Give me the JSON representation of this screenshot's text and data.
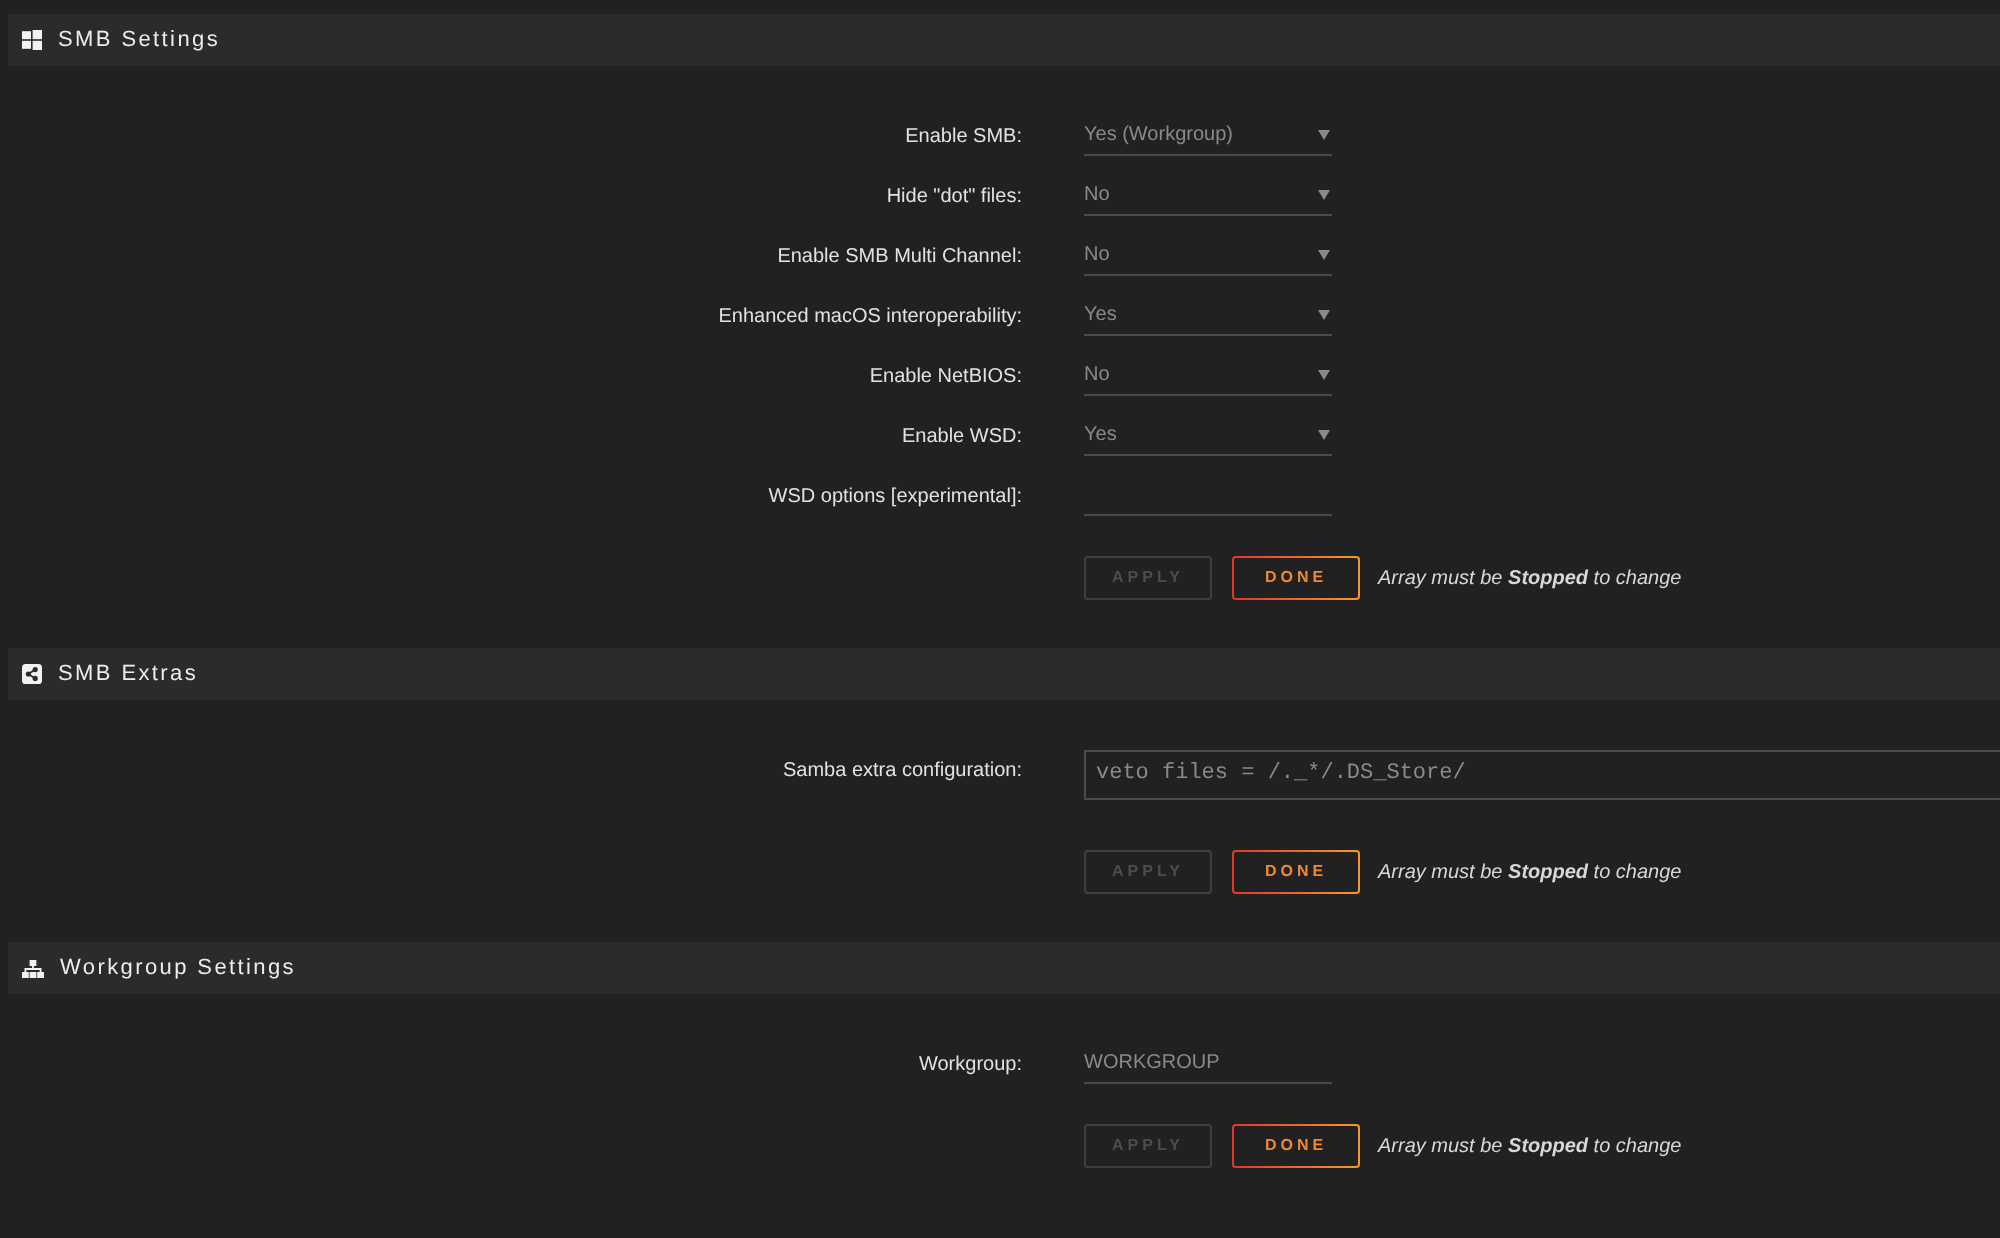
{
  "smb_settings": {
    "title": "SMB Settings",
    "fields": [
      {
        "kind": "select",
        "label": "Enable SMB:",
        "value": "Yes (Workgroup)"
      },
      {
        "kind": "select",
        "label": "Hide \"dot\" files:",
        "value": "No"
      },
      {
        "kind": "select",
        "label": "Enable SMB Multi Channel:",
        "value": "No"
      },
      {
        "kind": "select",
        "label": "Enhanced macOS interoperability:",
        "value": "Yes"
      },
      {
        "kind": "select",
        "label": "Enable NetBIOS:",
        "value": "No"
      },
      {
        "kind": "select",
        "label": "Enable WSD:",
        "value": "Yes"
      },
      {
        "kind": "text",
        "label": "WSD options [experimental]:"
      }
    ],
    "buttons": [
      {
        "label": "APPLY",
        "disabled": true
      },
      {
        "label": "DONE",
        "disabled": false
      }
    ],
    "note": "Array must be **Stopped** to change"
  },
  "smb_extras": {
    "title": "SMB Extras",
    "fields": [
      {
        "kind": "textarea",
        "label": "Samba extra configuration:",
        "value": "veto files = /._*/.DS_Store/"
      }
    ],
    "buttons": [
      {
        "label": "APPLY",
        "disabled": true
      },
      {
        "label": "DONE",
        "disabled": false
      }
    ],
    "note": "Array must be **Stopped** to change"
  },
  "workgroup_settings": {
    "title": "Workgroup Settings",
    "fields": [
      {
        "kind": "text",
        "label": "Workgroup:",
        "value": "WORKGROUP"
      }
    ],
    "buttons": [
      {
        "label": "APPLY",
        "disabled": true
      },
      {
        "label": "DONE",
        "disabled": false
      }
    ],
    "note": "Array must be **Stopped** to change"
  }
}
